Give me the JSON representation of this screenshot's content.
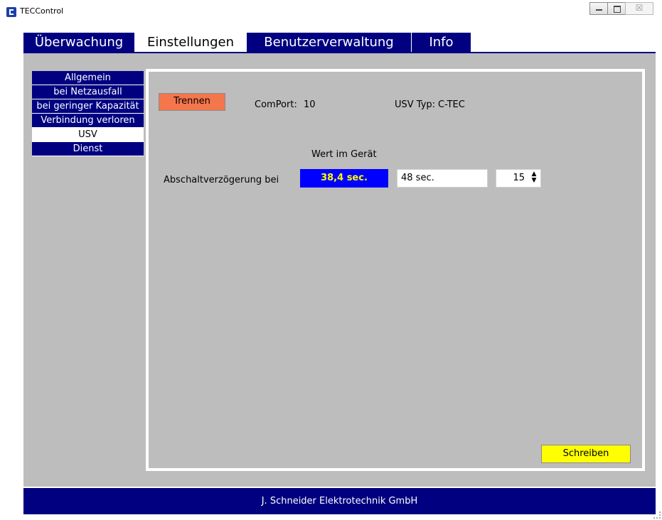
{
  "window": {
    "title": "TECControl",
    "close_glyph": "☒"
  },
  "tabs": [
    {
      "label": "Überwachung"
    },
    {
      "label": "Einstellungen"
    },
    {
      "label": "Benutzerverwaltung"
    },
    {
      "label": "Info"
    }
  ],
  "sidebar": {
    "items": [
      {
        "label": "Allgemein"
      },
      {
        "label": "bei Netzausfall"
      },
      {
        "label": "bei geringer Kapazität"
      },
      {
        "label": "Verbindung verloren"
      },
      {
        "label": "USV"
      },
      {
        "label": "Dienst"
      }
    ]
  },
  "usv": {
    "trennen_label": "Trennen",
    "comport_label": "ComPort:",
    "comport_value": "10",
    "usv_typ_label": "USV Typ:",
    "usv_typ_value": "C-TEC",
    "device_value_header": "Wert im Gerät",
    "abschalt_label": "Abschaltverzögerung bei",
    "device_value": "38,4 sec.",
    "set_value": "48 sec.",
    "stepper_value": "15",
    "schreiben_label": "Schreiben"
  },
  "footer": {
    "text": "J. Schneider Elektrotechnik GmbH"
  },
  "colors": {
    "navy": "#000080",
    "device_bg": "#0000ff",
    "device_text": "#ffff00",
    "trennen": "#f4764c",
    "schreiben": "#ffff00",
    "content_bg": "#bdbdbd"
  }
}
